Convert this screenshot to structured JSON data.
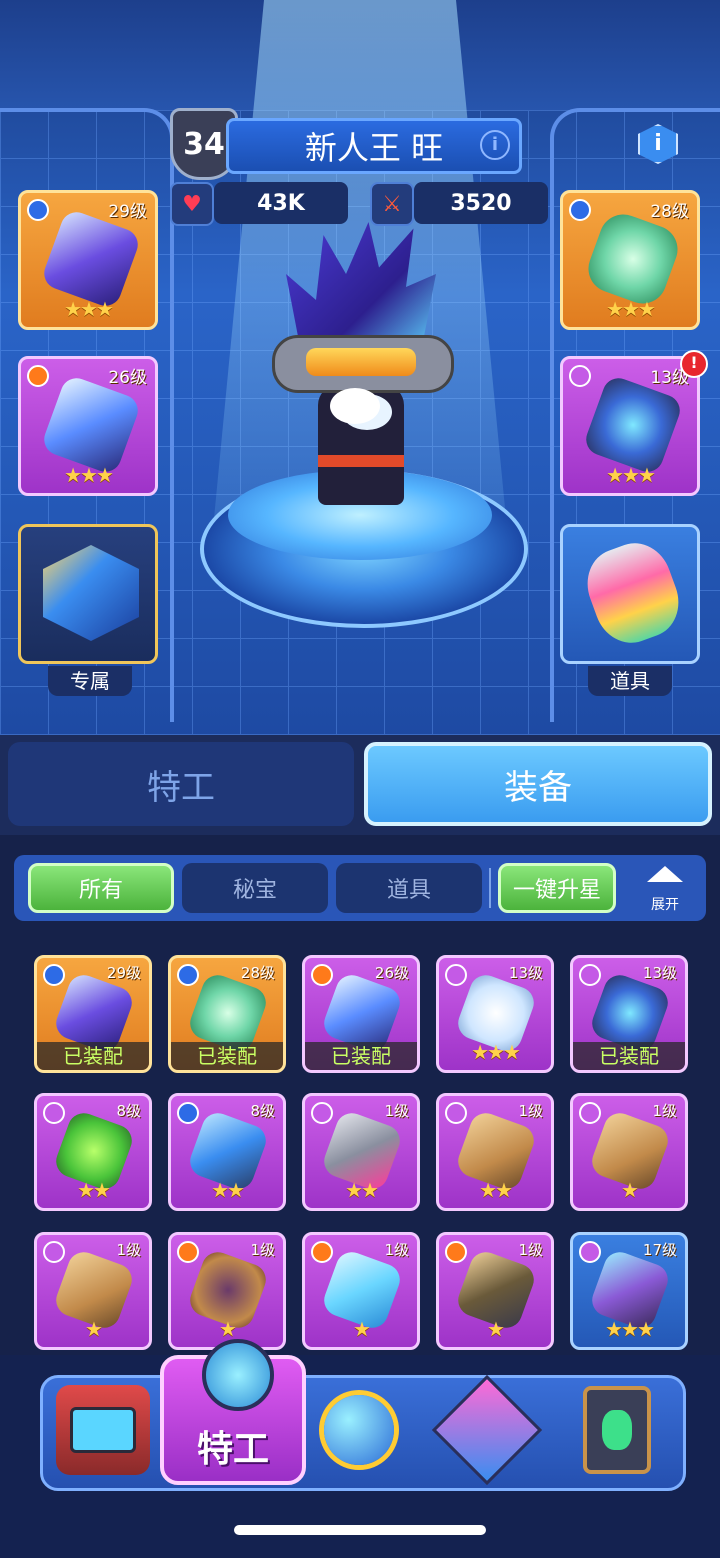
{
  "header": {
    "player_level": "34",
    "player_name": "新人王 旺",
    "name_info_icon": "i",
    "info_icon": "i"
  },
  "stats": {
    "hp": "43K",
    "attack": "3520"
  },
  "slots": {
    "left": [
      {
        "level": "29级",
        "rarity": "shield",
        "stars": "★★★",
        "color": "#f2a23e"
      },
      {
        "level": "26级",
        "rarity": "fire",
        "stars": "★★★",
        "color": "#c55ae6"
      },
      {
        "label": "专属"
      }
    ],
    "right": [
      {
        "level": "28级",
        "rarity": "shield",
        "stars": "★★★",
        "color": "#f2a23e"
      },
      {
        "level": "13级",
        "rarity": "ring",
        "stars": "★★★",
        "alert": "!",
        "color": "#c55ae6"
      },
      {
        "label": "道具"
      }
    ]
  },
  "main_tabs": {
    "agent": "特工",
    "equipment": "装备"
  },
  "filters": {
    "all": "所有",
    "treasure": "秘宝",
    "props": "道具",
    "upgrade": "一键升星",
    "expand": "展开"
  },
  "inventory": {
    "equipped_label": "已装配",
    "rows": [
      [
        {
          "level": "29级",
          "stars": "",
          "equipped": true,
          "bg": "orange",
          "rarity": "shield"
        },
        {
          "level": "28级",
          "stars": "",
          "equipped": true,
          "bg": "orange",
          "rarity": "shield"
        },
        {
          "level": "26级",
          "stars": "",
          "equipped": true,
          "bg": "purple",
          "rarity": "fire"
        },
        {
          "level": "13级",
          "stars": "★★★",
          "equipped": false,
          "bg": "purple",
          "rarity": "ring"
        },
        {
          "level": "13级",
          "stars": "",
          "equipped": true,
          "bg": "purple",
          "rarity": "ring"
        }
      ],
      [
        {
          "level": "8级",
          "stars": "★★",
          "equipped": false,
          "bg": "purple",
          "rarity": "ring"
        },
        {
          "level": "8级",
          "stars": "★★",
          "equipped": false,
          "bg": "purple",
          "rarity": "shield"
        },
        {
          "level": "1级",
          "stars": "★★",
          "equipped": false,
          "bg": "purple",
          "rarity": "ring"
        },
        {
          "level": "1级",
          "stars": "★★",
          "equipped": false,
          "bg": "purple",
          "rarity": "ring"
        },
        {
          "level": "1级",
          "stars": "★",
          "equipped": false,
          "bg": "purple",
          "rarity": "ring"
        }
      ],
      [
        {
          "level": "1级",
          "stars": "★",
          "equipped": false,
          "bg": "purple",
          "rarity": "ring"
        },
        {
          "level": "1级",
          "stars": "★",
          "equipped": false,
          "bg": "purple",
          "rarity": "fire"
        },
        {
          "level": "1级",
          "stars": "★",
          "equipped": false,
          "bg": "purple",
          "rarity": "fire"
        },
        {
          "level": "1级",
          "stars": "★",
          "equipped": false,
          "bg": "purple",
          "rarity": "fire"
        },
        {
          "level": "17级",
          "stars": "★★★",
          "equipped": false,
          "bg": "blue",
          "rarity": "ring"
        }
      ]
    ]
  },
  "nav": {
    "active_label": "特工"
  },
  "colors": {
    "accent_green": "#5cc44a",
    "accent_blue": "#3a9cf0",
    "equipped_text": "#c9ff64"
  }
}
